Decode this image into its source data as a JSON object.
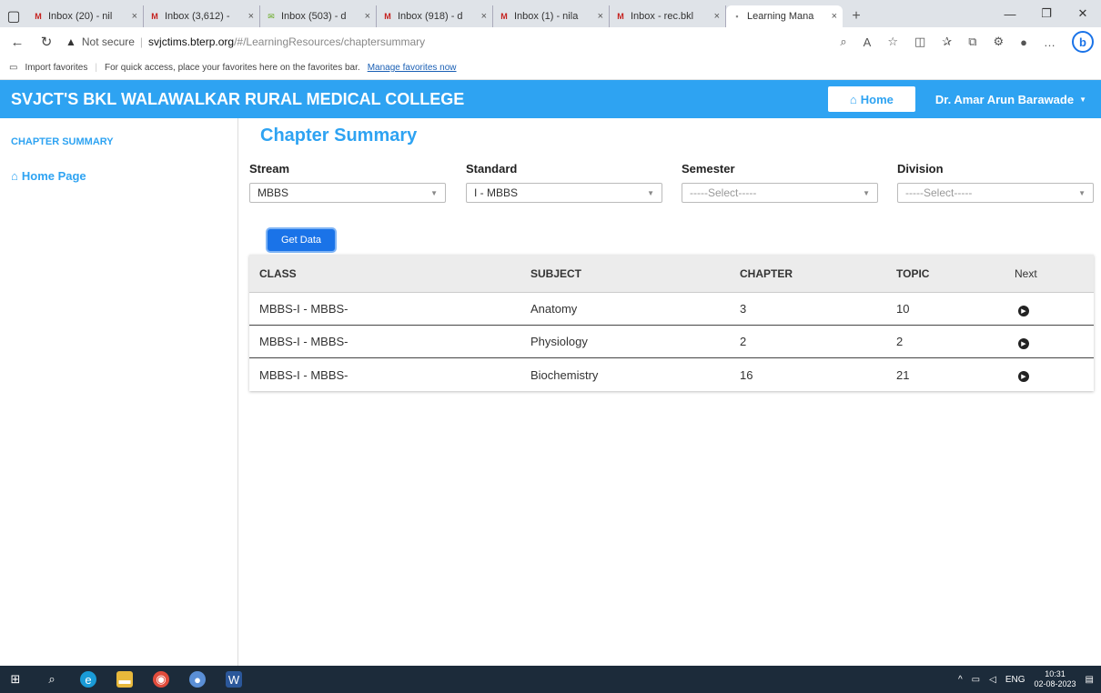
{
  "browser": {
    "tabs": [
      {
        "label": "Inbox (20) - nil",
        "icon": "gmail-icon",
        "color": "#c5221f"
      },
      {
        "label": "Inbox (3,612) -",
        "icon": "gmail-icon",
        "color": "#c5221f"
      },
      {
        "label": "Inbox (503) - d",
        "icon": "mail-icon",
        "color": "#6a2"
      },
      {
        "label": "Inbox (918) - d",
        "icon": "gmail-icon",
        "color": "#c5221f"
      },
      {
        "label": "Inbox (1) - nila",
        "icon": "gmail-icon",
        "color": "#c5221f"
      },
      {
        "label": "Inbox - rec.bkl",
        "icon": "gmail-icon",
        "color": "#c5221f"
      },
      {
        "label": "Learning Mana",
        "icon": "page-icon",
        "color": "#888",
        "active": true
      }
    ],
    "address": {
      "security": "Not secure",
      "host": "svjctims.bterp.org",
      "path": "/#/LearningResources/chaptersummary"
    },
    "favorites_bar": {
      "import": "Import favorites",
      "hint": "For quick access, place your favorites here on the favorites bar.",
      "manage": "Manage favorites now"
    }
  },
  "app": {
    "title": "SVJCT'S BKL WALAWALKAR RURAL MEDICAL COLLEGE",
    "home_button": "Home",
    "user": "Dr. Amar Arun Barawade",
    "colors": {
      "accent": "#2ea3f2",
      "button": "#1a73e8"
    }
  },
  "sidebar": {
    "section": "CHAPTER SUMMARY",
    "home_link": "Home Page"
  },
  "main": {
    "title": "Chapter Summary",
    "filters": [
      {
        "label": "Stream",
        "value": "MBBS",
        "placeholder": false
      },
      {
        "label": "Standard",
        "value": "I - MBBS",
        "placeholder": false
      },
      {
        "label": "Semester",
        "value": "-----Select-----",
        "placeholder": true
      },
      {
        "label": "Division",
        "value": "-----Select-----",
        "placeholder": true
      }
    ],
    "get_data": "Get Data",
    "table": {
      "headers": [
        "CLASS",
        "SUBJECT",
        "CHAPTER",
        "TOPIC",
        "Next"
      ],
      "rows": [
        [
          "MBBS-I - MBBS-",
          "Anatomy",
          "3",
          "10"
        ],
        [
          "MBBS-I - MBBS-",
          "Physiology",
          "2",
          "2"
        ],
        [
          "MBBS-I - MBBS-",
          "Biochemistry",
          "16",
          "21"
        ]
      ]
    }
  },
  "taskbar": {
    "lang": "ENG",
    "time": "10:31",
    "date": "02-08-2023"
  }
}
